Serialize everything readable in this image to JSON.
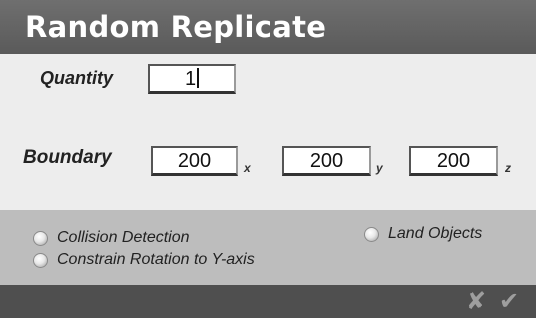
{
  "dialog": {
    "title": "Random Replicate"
  },
  "quantity": {
    "label": "Quantity",
    "value": "1"
  },
  "boundary": {
    "label": "Boundary",
    "x": {
      "value": "200",
      "axis": "x"
    },
    "y": {
      "value": "200",
      "axis": "y"
    },
    "z": {
      "value": "200",
      "axis": "z"
    }
  },
  "options": {
    "collision": {
      "label": "Collision Detection",
      "selected": false
    },
    "constrain": {
      "label": "Constrain Rotation to Y-axis",
      "selected": false
    },
    "land": {
      "label": "Land Objects",
      "selected": false
    }
  },
  "footer": {
    "cancel_icon": "x-icon",
    "ok_icon": "checkmark-icon"
  }
}
